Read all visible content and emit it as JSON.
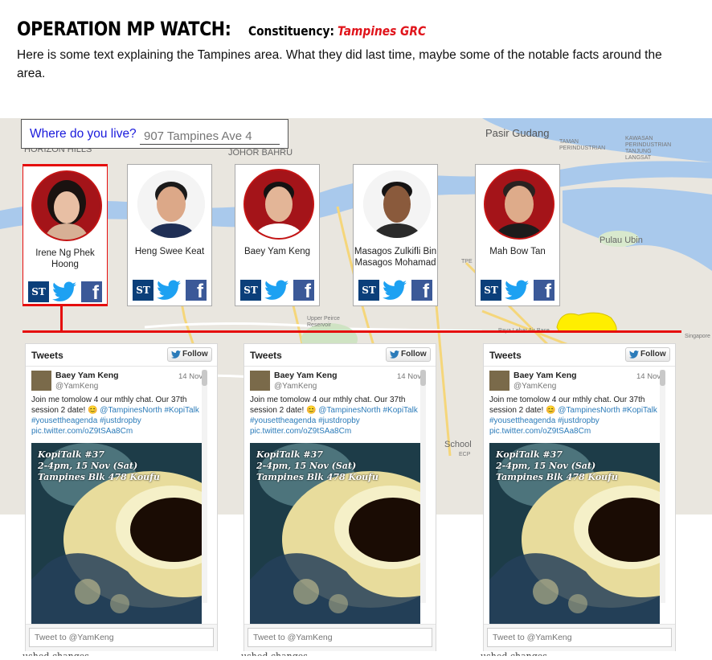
{
  "header": {
    "title": "OPERATION MP WATCH:",
    "constituency_label": "Constituency:",
    "constituency_value": "Tampines GRC",
    "intro": "Here is some text explaining the Tampines area. What they did last time, maybe some of the notable facts around the area."
  },
  "search": {
    "label": "Where do you live?",
    "placeholder": "907 Tampines Ave 4"
  },
  "map": {
    "labels": [
      "Pasir Gudang",
      "HORIZON HILLS",
      "JOHOR BAHRU",
      "TAMAN PERINDUSTRIAN",
      "KAWASAN PERINDUSTRIAN TANJUNG LANGSAT",
      "Pulau Ubin",
      "Upper Peirce Reservoir",
      "Paya Lebar Air Base",
      "Singapore",
      "School",
      "TPE",
      "ECP"
    ]
  },
  "mps": [
    {
      "name": "Irene Ng Phek Hoong",
      "active": true
    },
    {
      "name": "Heng Swee Keat",
      "active": false
    },
    {
      "name": "Baey Yam Keng",
      "active": false
    },
    {
      "name": "Masagos Zulkifli Bin Masagos Mohamad",
      "active": false
    },
    {
      "name": "Mah Bow Tan",
      "active": false
    }
  ],
  "social": {
    "st": "ST"
  },
  "tweet_panels": [
    {
      "title": "Tweets",
      "follow": "Follow",
      "author": "Baey Yam Keng",
      "handle": "@YamKeng",
      "date": "14 Nov",
      "text": "Join me tomolow 4 our mthly chat. Our 37th session 2 date! 😊",
      "links": "@TampinesNorth #KopiTalk #yousettheagenda #justdropby pic.twitter.com/oZ9tSAa8Cm",
      "image_caption": [
        "KopiTalk #37",
        "2-4pm, 15 Nov (Sat)",
        "Tampines Blk 478 Koufu"
      ],
      "input_placeholder": "Tweet to @YamKeng"
    },
    {
      "title": "Tweets",
      "follow": "Follow",
      "author": "Baey Yam Keng",
      "handle": "@YamKeng",
      "date": "14 Nov",
      "text": "Join me tomolow 4 our mthly chat. Our 37th session 2 date! 😊",
      "links": "@TampinesNorth #KopiTalk #yousettheagenda #justdropby pic.twitter.com/oZ9tSAa8Cm",
      "image_caption": [
        "KopiTalk #37",
        "2-4pm, 15 Nov (Sat)",
        "Tampines Blk 478 Koufu"
      ],
      "input_placeholder": "Tweet to @YamKeng"
    },
    {
      "title": "Tweets",
      "follow": "Follow",
      "author": "Baey Yam Keng",
      "handle": "@YamKeng",
      "date": "14 Nov",
      "text": "Join me tomolow 4 our mthly chat. Our 37th session 2 date! 😊",
      "links": "@TampinesNorth #KopiTalk #yousettheagenda #justdropby pic.twitter.com/oZ9tSAa8Cm",
      "image_caption": [
        "KopiTalk #37",
        "2-4pm, 15 Nov (Sat)",
        "Tampines Blk 478 Koufu"
      ],
      "input_placeholder": "Tweet to @YamKeng"
    }
  ],
  "footer_fragment": "ushed changes",
  "colors": {
    "accent_red": "#e50d0d",
    "link_blue": "#1a1adc",
    "st_blue": "#0b3f7a",
    "facebook": "#3b5998",
    "twitter": "#1da1f2"
  }
}
